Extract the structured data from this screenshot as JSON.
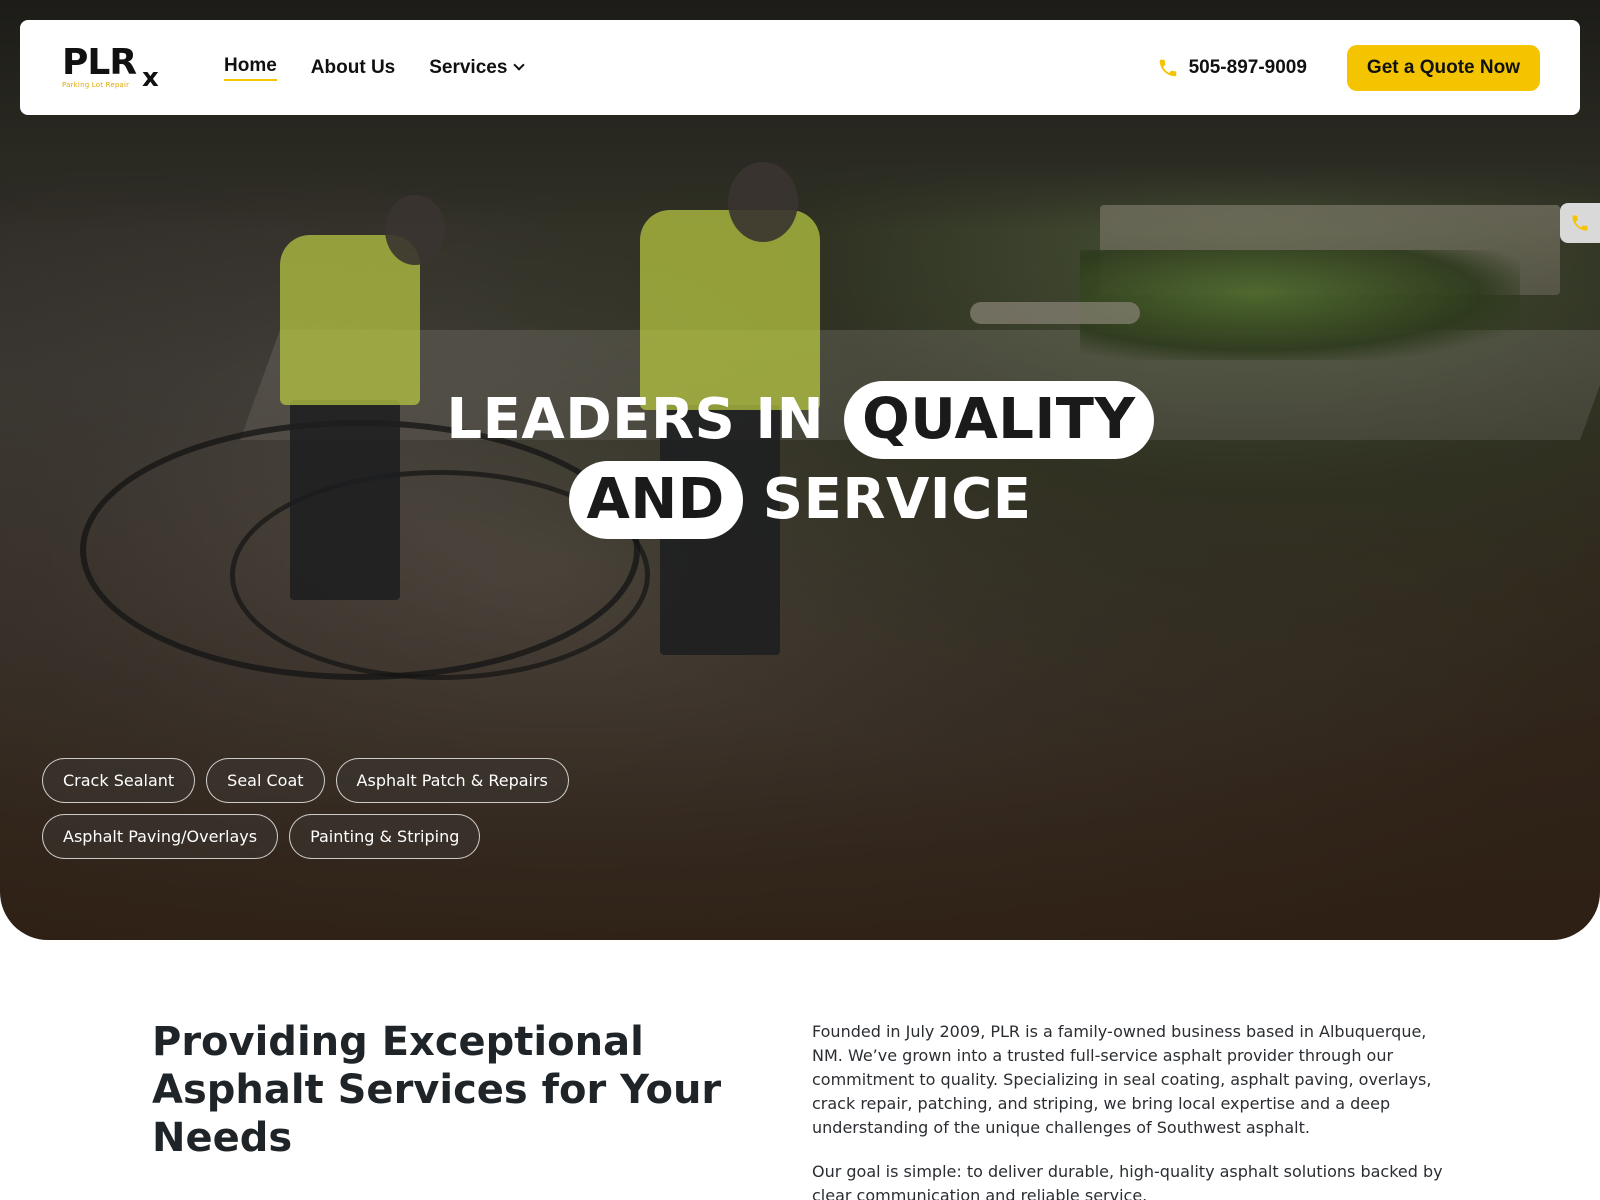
{
  "header": {
    "logo_text": "PLR",
    "logo_mark": "x",
    "logo_tagline": "Parking Lot Repair",
    "nav": [
      {
        "label": "Home",
        "active": true
      },
      {
        "label": "About Us",
        "active": false
      },
      {
        "label": "Services",
        "active": false,
        "has_dropdown": true
      }
    ],
    "phone": "505-897-9009",
    "phone_icon": "phone-icon",
    "cta_label": "Get a Quote Now",
    "accent_color": "#f5c400"
  },
  "hero": {
    "headline_part1": "LEADERS IN",
    "headline_highlight1": "QUALITY",
    "headline_highlight2": "AND",
    "headline_part2": "SERVICE",
    "services": [
      "Crack Sealant",
      "Seal Coat",
      "Asphalt Patch & Repairs",
      "Asphalt Paving/Overlays",
      "Painting & Striping"
    ]
  },
  "intro": {
    "title": "Providing Exceptional Asphalt Services for Your Needs",
    "paragraph1": "Founded in July 2009, PLR is a family-owned business based in Albuquerque, NM. We’ve grown into a trusted full-service asphalt provider through our commitment to quality. Specializing in seal coating, asphalt paving, overlays, crack repair, patching, and striping, we bring local expertise and a deep understanding of the unique challenges of Southwest asphalt.",
    "paragraph2": "Our goal is simple: to deliver durable, high-quality asphalt solutions backed by clear communication and reliable service."
  }
}
